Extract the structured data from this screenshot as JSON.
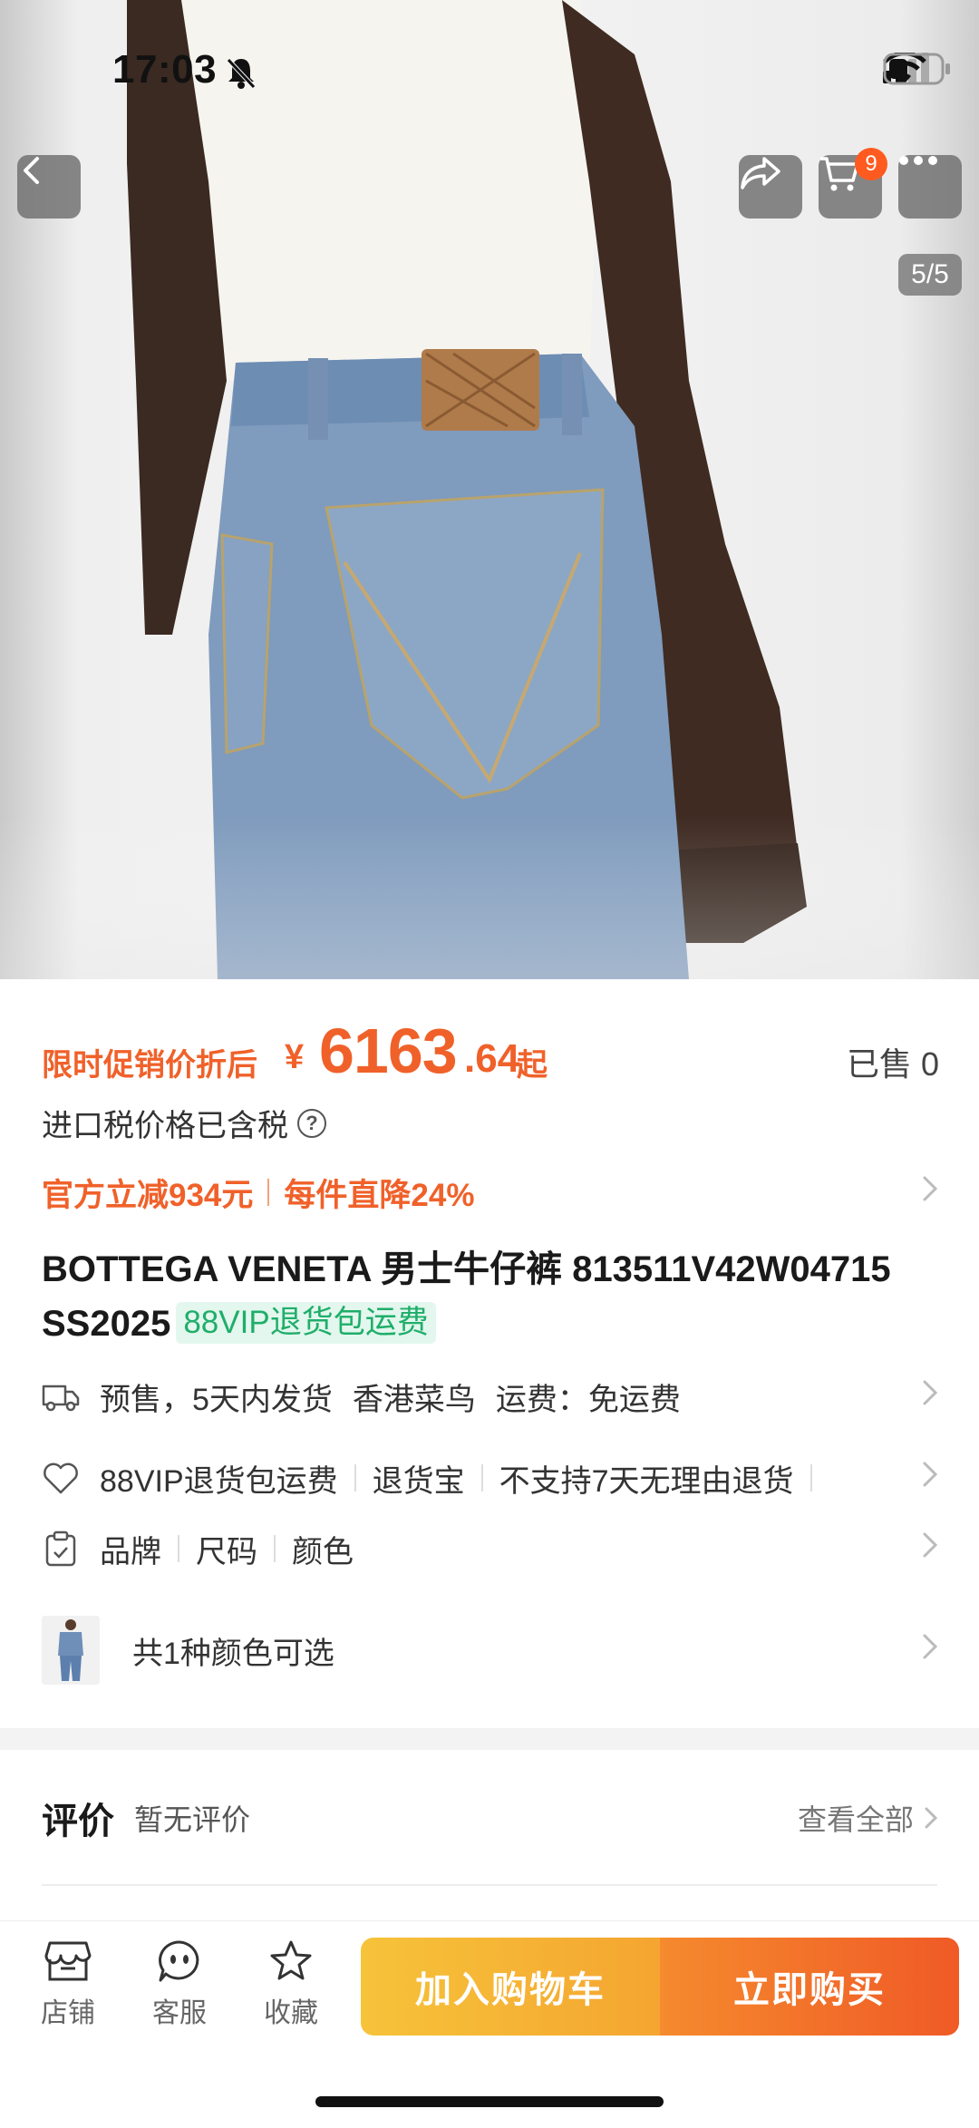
{
  "status_bar": {
    "time": "17:03"
  },
  "gallery": {
    "counter": "5/5",
    "cart_count": "9"
  },
  "price": {
    "promo_label": "限时促销价折后",
    "currency": "¥",
    "integer": "6163",
    "decimal": ".64",
    "suffix": "起",
    "sold": "已售 0"
  },
  "tax_note": "进口税价格已含税",
  "discounts": {
    "first": "官方立减934元",
    "second": "每件直降24%"
  },
  "product": {
    "title": "BOTTEGA VENETA 男士牛仔裤 813511V42W04715 SS2025",
    "vip_tag": "88VIP退货包运费"
  },
  "shipping": {
    "presale": "预售，5天内发货",
    "origin": "香港菜鸟",
    "fee": "运费：免运费"
  },
  "services": {
    "item1": "88VIP退货包运费",
    "item2": "退货宝",
    "item3": "不支持7天无理由退货"
  },
  "params": {
    "item1": "品牌",
    "item2": "尺码",
    "item3": "颜色"
  },
  "colors": {
    "label": "共1种颜色可选"
  },
  "reviews": {
    "title": "评价",
    "empty": "暂无评价",
    "view_all": "查看全部"
  },
  "bottom_bar": {
    "store": "店铺",
    "service": "客服",
    "favorite": "收藏",
    "add_to_cart": "加入购物车",
    "buy_now": "立即购买"
  },
  "colors_theme": {
    "accent": "#f0612a",
    "vip_green": "#1fae6a",
    "cart_yellow": "#f6c33a",
    "buy_orange": "#f05a26"
  }
}
